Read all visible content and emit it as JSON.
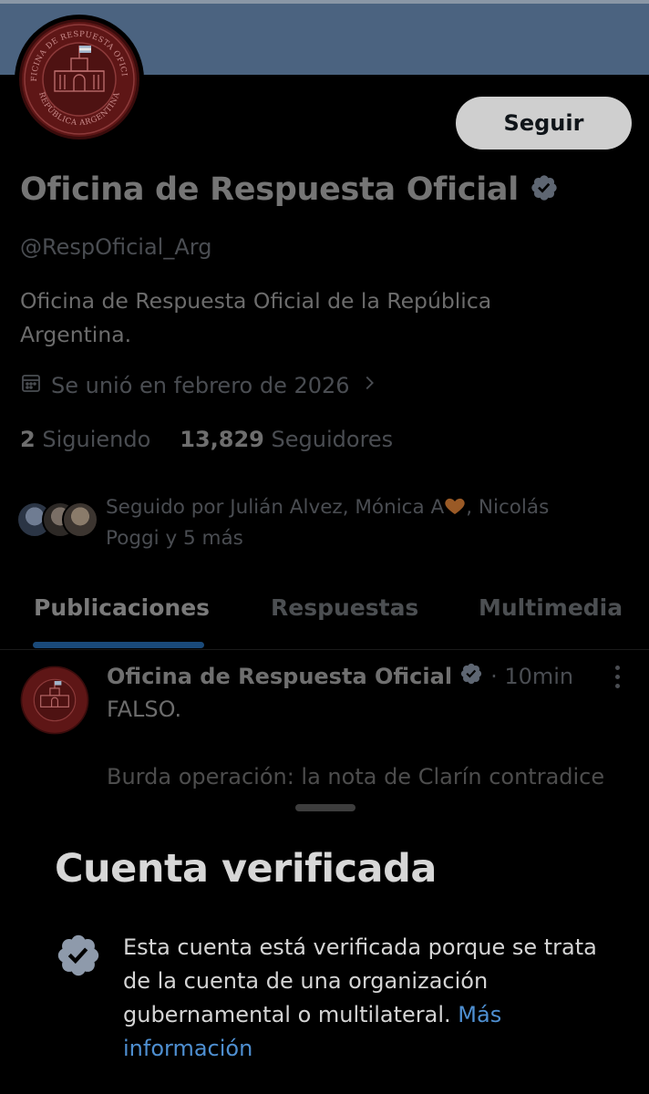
{
  "profile": {
    "display_name": "Oficina de Respuesta Oficial",
    "handle": "@RespOficial_Arg",
    "bio": "Oficina de Respuesta Oficial de la República Argentina.",
    "joined": "Se unió en febrero de 2026",
    "follow_label": "Seguir",
    "avatar_seal": {
      "top_text": "OFICINA DE RESPUESTA OFICIAL",
      "bottom_text": "REPÚBLICA ARGENTINA"
    }
  },
  "stats": {
    "following_count": "2",
    "following_label": "Siguiendo",
    "followers_count": "13,829",
    "followers_label": "Seguidores"
  },
  "followed_by": {
    "prefix": "Seguido por Julián Alvez, Mónica A",
    "suffix": ", Nicolás Poggi y 5 más"
  },
  "tabs": [
    {
      "label": "Publicaciones",
      "active": true
    },
    {
      "label": "Respuestas",
      "active": false
    },
    {
      "label": "Multimedia",
      "active": false
    }
  ],
  "post": {
    "author": "Oficina de Respuesta Oficial",
    "time": "· 10min",
    "line1": "FALSO.",
    "line2": "Burda operación: la nota de Clarín contradice"
  },
  "sheet": {
    "title": "Cuenta verificada",
    "body": "Esta cuenta está verificada porque se trata de la cuenta de una organización gubernamental o multilateral.",
    "link": "Más información"
  },
  "colors": {
    "banner": "#4b6380",
    "seal_red": "#6e1a1a",
    "link": "#4e8fd1",
    "badge_gray": "#8e9aab"
  }
}
